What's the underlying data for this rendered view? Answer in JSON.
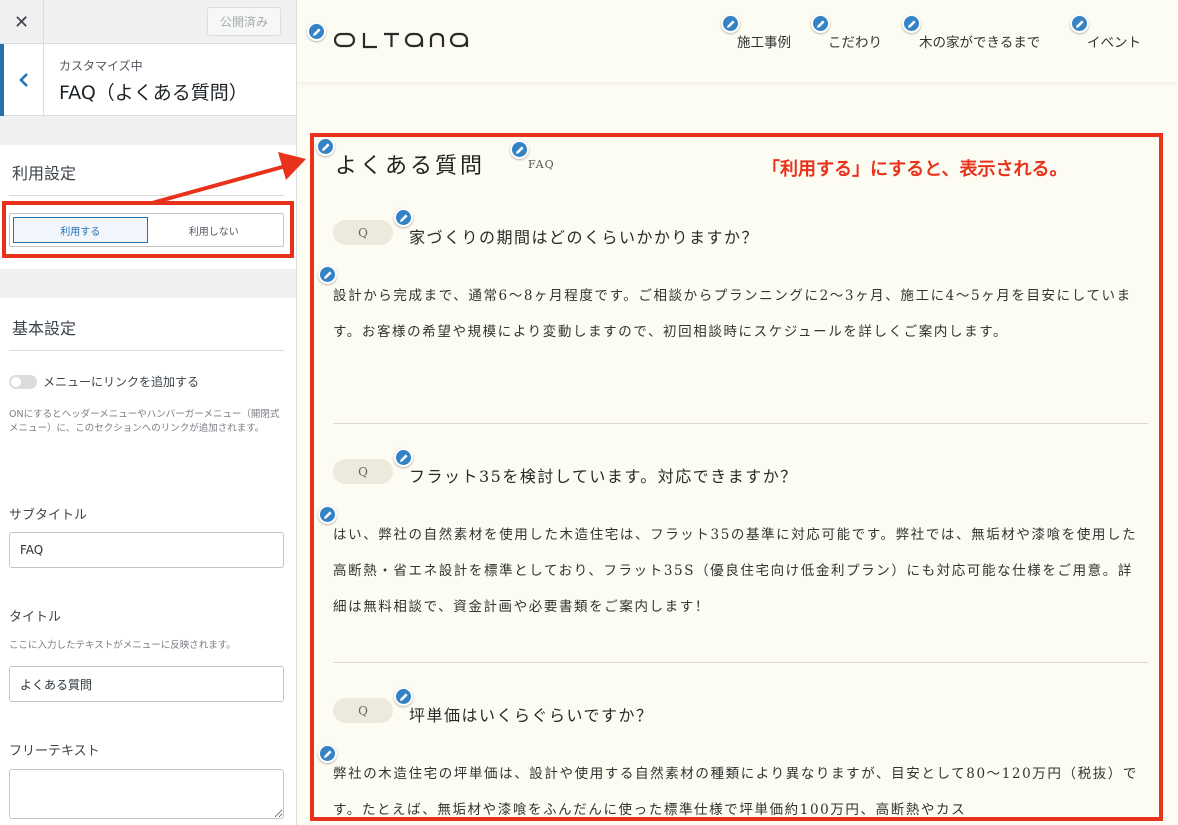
{
  "sidebar": {
    "publish_label": "公開済み",
    "header_sub": "カスタマイズ中",
    "header_title": "FAQ（よくある質問）",
    "usage": {
      "heading": "利用設定",
      "options": [
        "利用する",
        "利用しない"
      ],
      "selected": "利用する"
    },
    "basic": {
      "heading": "基本設定",
      "menu_toggle_label": "メニューにリンクを追加する",
      "menu_toggle_on": false,
      "menu_toggle_desc": "ONにするとヘッダーメニューやハンバーガーメニュー（開閉式メニュー）に、このセクションへのリンクが追加されます。",
      "subtitle_label": "サブタイトル",
      "subtitle_value": "FAQ",
      "title_label": "タイトル",
      "title_desc": "ここに入力したテキストがメニューに反映されます。",
      "title_value": "よくある質問",
      "free_text_label": "フリーテキスト",
      "free_text_value": ""
    }
  },
  "site": {
    "logo": "OLTANA",
    "nav": [
      "施工事例",
      "こだわり",
      "木の家ができるまで",
      "イベント"
    ]
  },
  "faq": {
    "title": "よくある質問",
    "subtitle": "FAQ",
    "badge": "Q",
    "items": [
      {
        "q": "家づくりの期間はどのくらいかかりますか？",
        "a": "設計から完成まで、通常6〜8ヶ月程度です。ご相談からプランニングに2〜3ヶ月、施工に4〜5ヶ月を目安にしています。お客様の希望や規模により変動しますので、初回相談時にスケジュールを詳しくご案内します。"
      },
      {
        "q": "フラット35を検討しています。対応できますか？",
        "a": "はい、弊社の自然素材を使用した木造住宅は、フラット35の基準に対応可能です。弊社では、無垢材や漆喰を使用した高断熱・省エネ設計を標準としており、フラット35S（優良住宅向け低金利プラン）にも対応可能な仕様をご用意。詳細は無料相談で、資金計画や必要書類をご案内します！"
      },
      {
        "q": "坪単価はいくらぐらいですか？",
        "a": "弊社の木造住宅の坪単価は、設計や使用する自然素材の種類により異なりますが、目安として80〜120万円（税抜）です。たとえば、無垢材や漆喰をふんだんに使った標準仕様で坪単価約100万円、高断熱やカス"
      }
    ]
  },
  "annotation": {
    "note": "「利用する」にすると、表示される。",
    "color": "#e8321b"
  },
  "colors": {
    "accent": "#2271b1",
    "edit_pen": "#3582c4",
    "page_bg": "#fdfcf3"
  }
}
